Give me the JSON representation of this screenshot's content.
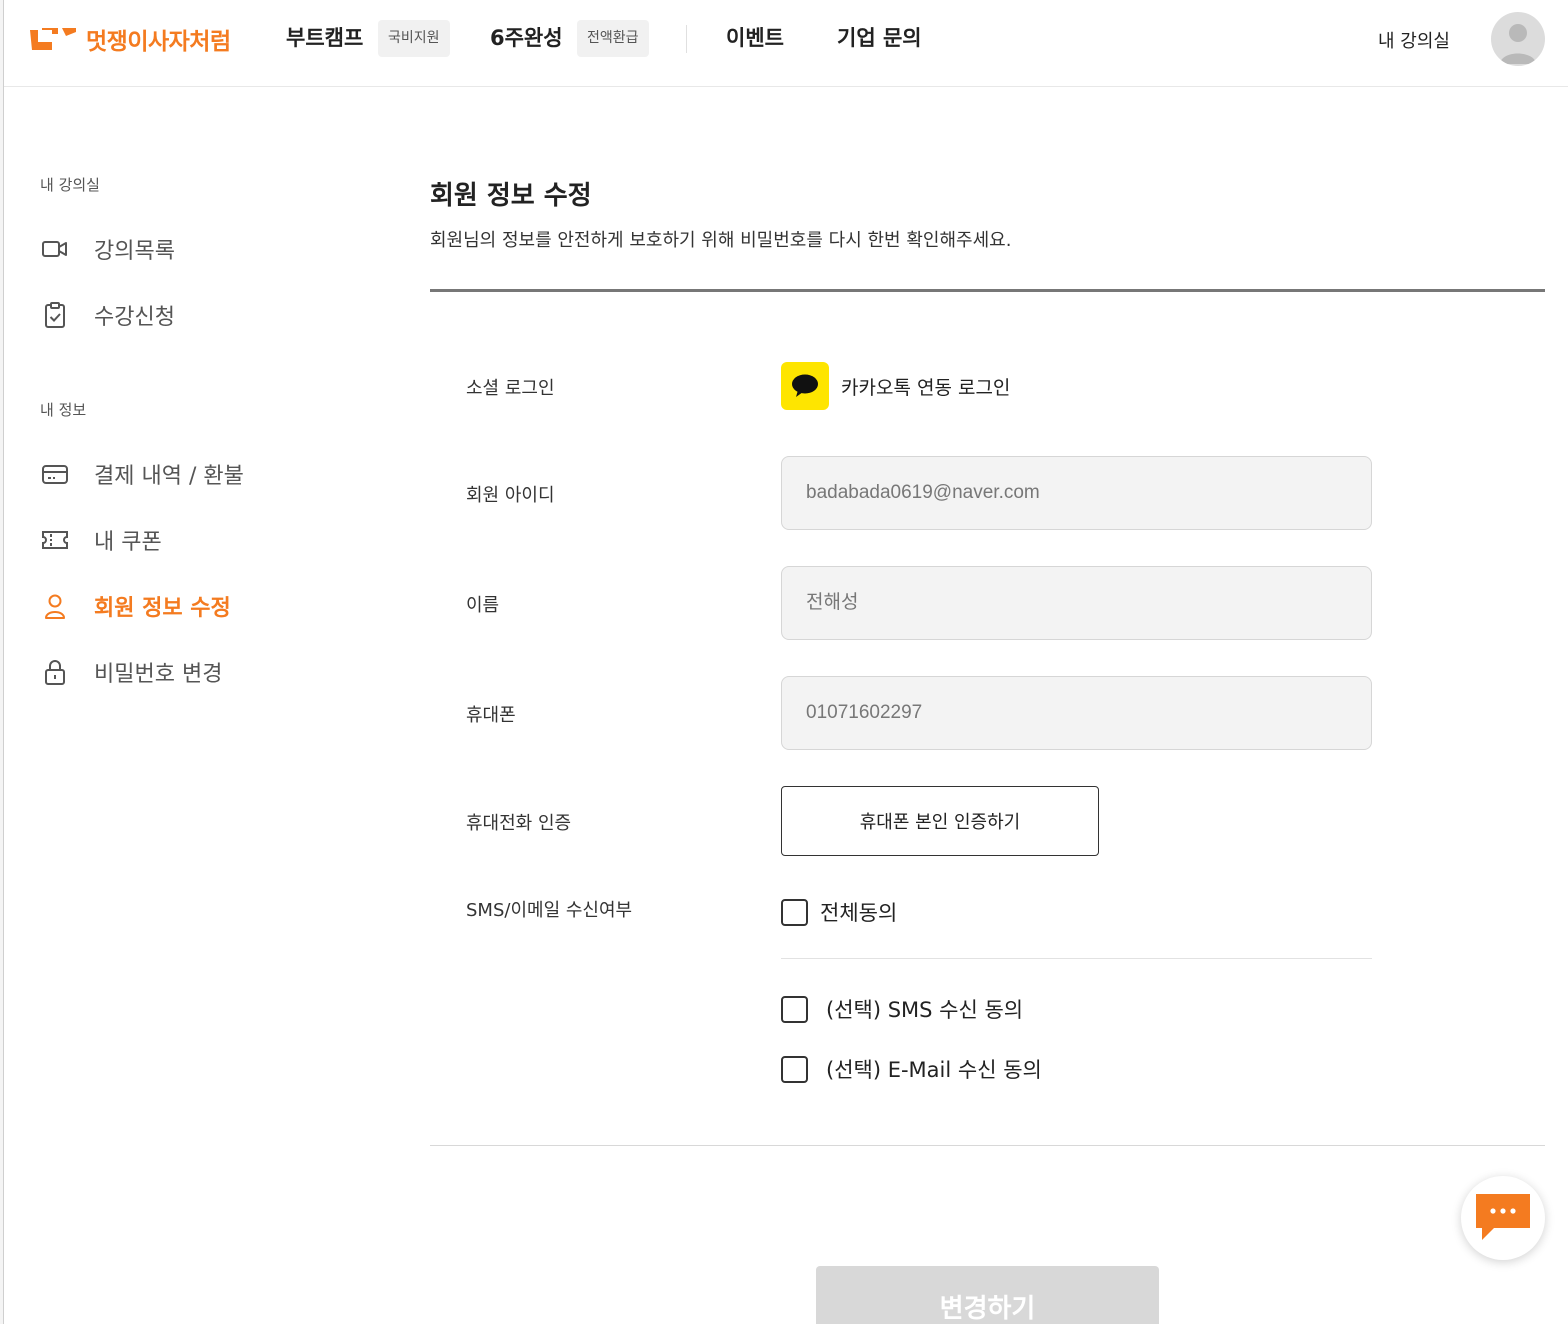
{
  "header": {
    "logo_text": "멋쟁이사자처럼",
    "nav": [
      {
        "label": "부트캠프",
        "badge": "국비지원"
      },
      {
        "label": "6주완성",
        "badge": "전액환급"
      },
      {
        "label": "이벤트"
      },
      {
        "label": "기업 문의"
      }
    ],
    "my_class": "내 강의실"
  },
  "sidebar": {
    "section1": "내 강의실",
    "section1_items": [
      {
        "label": "강의목록",
        "icon": "video-icon"
      },
      {
        "label": "수강신청",
        "icon": "clipboard-check-icon"
      }
    ],
    "section2": "내 정보",
    "section2_items": [
      {
        "label": "결제 내역 / 환불",
        "icon": "credit-card-icon"
      },
      {
        "label": "내 쿠폰",
        "icon": "ticket-icon"
      },
      {
        "label": "회원 정보 수정",
        "icon": "user-icon",
        "active": true
      },
      {
        "label": "비밀번호 변경",
        "icon": "lock-icon"
      }
    ]
  },
  "main": {
    "title": "회원 정보 수정",
    "description": "회원님의 정보를 안전하게 보호하기 위해 비밀번호를 다시 한번 확인해주세요.",
    "social_login_label": "소셜 로그인",
    "kakao_text": "카카오톡 연동 로그인",
    "member_id_label": "회원 아이디",
    "member_id_value": "badabada0619@naver.com",
    "name_label": "이름",
    "name_value": "전해성",
    "phone_label": "휴대폰",
    "phone_value": "01071602297",
    "phone_verify_label": "휴대전화 인증",
    "phone_verify_button": "휴대폰 본인 인증하기",
    "consent_label": "SMS/이메일 수신여부",
    "consent_all": "전체동의",
    "consent_sms": "(선택) SMS 수신 동의",
    "consent_email": "(선택) E-Mail 수신 동의",
    "submit_button": "변경하기"
  },
  "colors": {
    "brand": "#f47b20",
    "kakao": "#fee500"
  }
}
